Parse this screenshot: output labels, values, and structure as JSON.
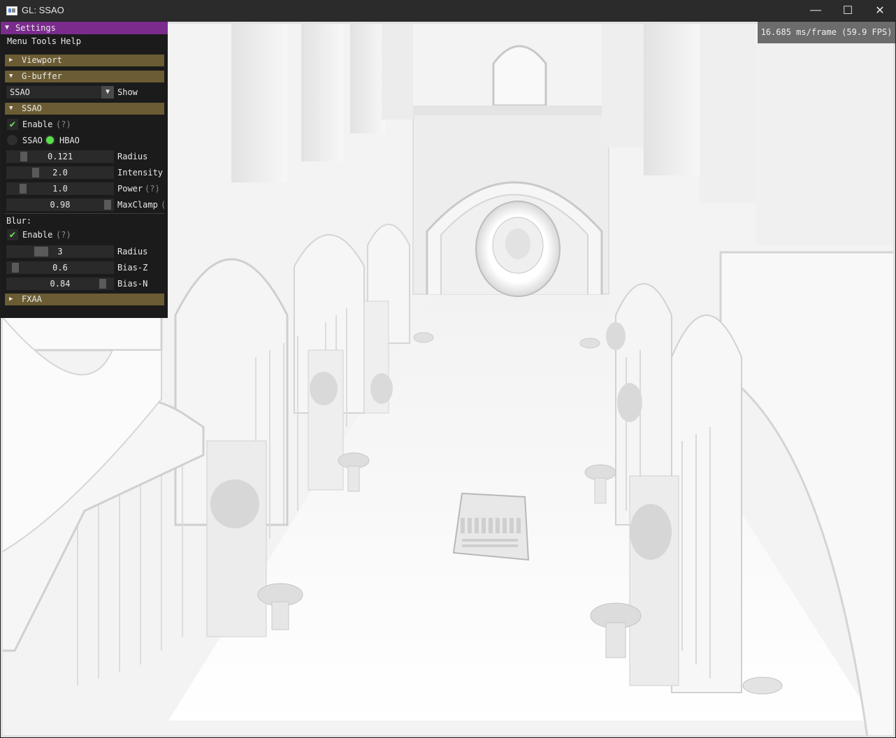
{
  "window": {
    "title": "GL: SSAO",
    "minimize_glyph": "—",
    "maximize_glyph": "☐",
    "close_glyph": "✕"
  },
  "overlay": {
    "fps_text": "16.685 ms/frame (59.9 FPS)"
  },
  "panel": {
    "title": "Settings",
    "collapse_glyph": "▼",
    "menu": [
      "Menu",
      "Tools",
      "Help"
    ],
    "sections": {
      "viewport": {
        "label": "Viewport",
        "arrow": "▶"
      },
      "gbuffer": {
        "label": "G-buffer",
        "arrow": "▼"
      },
      "ssao": {
        "label": "SSAO",
        "arrow": "▼"
      },
      "fxaa": {
        "label": "FXAA",
        "arrow": "▶"
      }
    },
    "gbuffer_show": {
      "value": "SSAO",
      "label": "Show",
      "arrow": "▼"
    },
    "ssao": {
      "enable_label": "Enable",
      "enable_hint": "(?)",
      "enabled": true,
      "mode_options": [
        "SSAO",
        "HBAO"
      ],
      "mode_selected": "HBAO",
      "radius": {
        "value": "0.121",
        "label": "Radius",
        "level": 0.121
      },
      "intensity": {
        "value": "2.0",
        "label": "Intensity",
        "level": 0.2
      },
      "power": {
        "value": "1.0",
        "label": "Power",
        "hint": "(?)",
        "level": 0.1
      },
      "maxclamp": {
        "value": "0.98",
        "label": "MaxClamp",
        "hint": "(",
        "level": 0.98
      }
    },
    "blur": {
      "heading": "Blur:",
      "enable_label": "Enable",
      "enable_hint": "(?)",
      "enabled": true,
      "radius": {
        "value": "3",
        "label": "Radius",
        "level": 0.3
      },
      "bias_z": {
        "value": "0.6",
        "label": "Bias-Z",
        "level": 0.06
      },
      "bias_n": {
        "value": "0.84",
        "label": "Bias-N",
        "level": 0.9
      }
    },
    "check_glyph": "✔"
  },
  "colors": {
    "title_bar": "#7a2c8c",
    "header": "#6b5c33",
    "radio_on": "#58e04a",
    "check": "#6ee35a"
  }
}
